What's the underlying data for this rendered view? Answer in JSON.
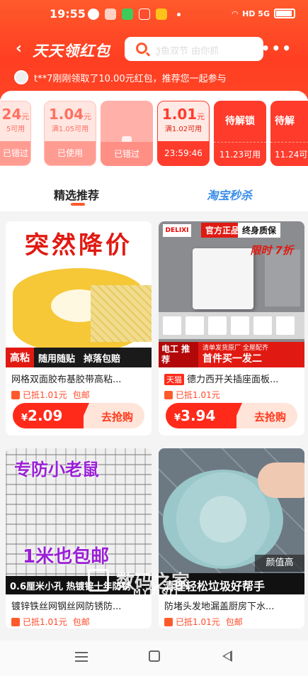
{
  "status_bar": {
    "time": "19:55",
    "signal_text": "HD 5G"
  },
  "header": {
    "title": "天天领红包",
    "search_placeholder": "ѯ鱼双节 由你抓",
    "notice": "t**7刚刚领取了10.00元红包，推荐您一起参与"
  },
  "coupons": [
    {
      "amount": "24",
      "unit": "元",
      "condition": "5可用",
      "status": "已错过",
      "style": "light"
    },
    {
      "amount": "1.04",
      "unit": "元",
      "condition": "满1.05可用",
      "status": "已使用",
      "style": "light"
    },
    {
      "amount": "",
      "unit": "",
      "condition": "",
      "status": "已错过",
      "style": "pink"
    },
    {
      "amount": "1.01",
      "unit": "元",
      "condition": "满1.02可用",
      "status": "23:59:46",
      "style": "red"
    },
    {
      "amount": "待解锁",
      "unit": "",
      "condition": "",
      "status": "11.23可用",
      "style": "lock"
    },
    {
      "amount": "待解",
      "unit": "",
      "condition": "",
      "status": "11.24可",
      "style": "lock"
    }
  ],
  "tabs": {
    "recommended": "精选推荐",
    "seckill": "淘宝秒杀"
  },
  "products": [
    {
      "name": "网格双面胶布基胶带高粘...",
      "tmall": "",
      "coupon": "已抵1.01元",
      "shipping": "包邮",
      "price_symbol": "¥",
      "price": "2.09",
      "buy": "去抢购",
      "image": {
        "headline": "突然降价",
        "tag1": "高粘",
        "tag2": "随用随贴",
        "tag3": "掉落包赔"
      }
    },
    {
      "name": "德力西开关插座面板...",
      "tmall": "天猫",
      "coupon": "已抵1.01元",
      "shipping": "",
      "price_symbol": "¥",
      "price": "3.94",
      "buy": "去抢购",
      "image": {
        "logo": "DELIXI",
        "tag1": "官方正品",
        "tag2": "终身质保",
        "limit": "限时 7折",
        "promo_left": "电工 推荐",
        "promo_top": "清单发货原厂 全屋配齐",
        "promo_main": "首件买一发二"
      }
    },
    {
      "name": "镀锌铁丝网钢丝网防锈防...",
      "tmall": "",
      "coupon": "已抵1.01元",
      "shipping": "包邮",
      "image": {
        "top": "专防小老鼠",
        "middle": "1米也包邮",
        "bottom": "0.6厘米小孔  热镀锌十年防锈"
      }
    },
    {
      "name": "防堵头发地漏盖厨房下水...",
      "tmall": "",
      "coupon": "已抵1.01元",
      "shipping": "包邮",
      "image": {
        "tag": "颜值高",
        "bottom": "清理轻松垃圾好帮手"
      }
    }
  ],
  "watermark": {
    "text": "数码之家",
    "sub": "MYDIGIT"
  }
}
